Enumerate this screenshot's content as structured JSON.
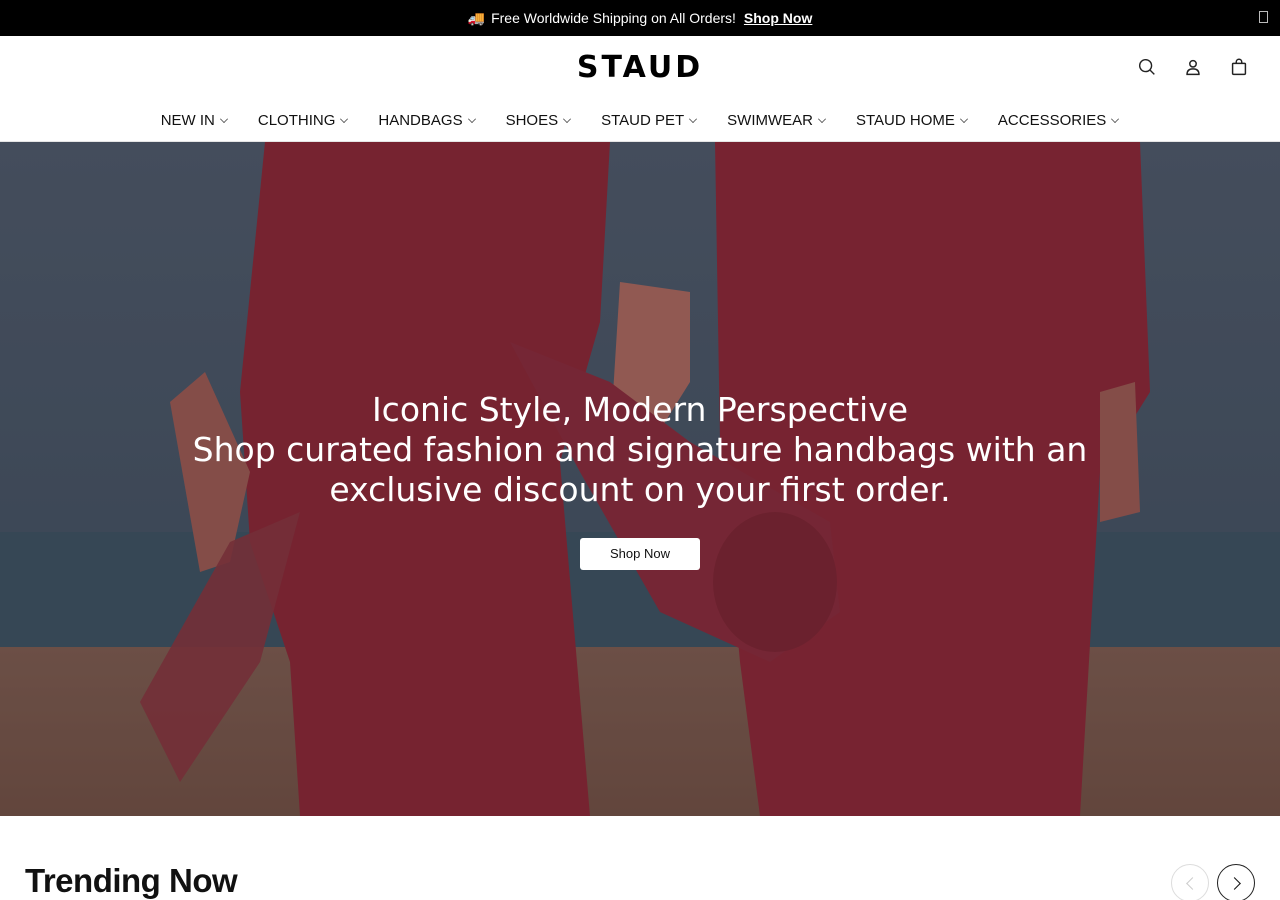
{
  "announcement": {
    "icon": "truck-icon",
    "text": "Free Worldwide Shipping on All Orders!",
    "link_label": "Shop Now"
  },
  "header": {
    "logo": "STAUD",
    "icons": [
      "search-icon",
      "account-icon",
      "bag-icon"
    ]
  },
  "nav": {
    "items": [
      {
        "label": "NEW IN"
      },
      {
        "label": "CLOTHING"
      },
      {
        "label": "HANDBAGS"
      },
      {
        "label": "SHOES"
      },
      {
        "label": "STAUD PET"
      },
      {
        "label": "SWIMWEAR"
      },
      {
        "label": "STAUD HOME"
      },
      {
        "label": "ACCESSORIES"
      }
    ]
  },
  "hero": {
    "title": "Iconic Style, Modern Perspective",
    "subtitle": "Shop curated fashion and signature handbags with an exclusive discount on your first order.",
    "button_label": "Shop Now",
    "colors": {
      "sky": "#3d6e80",
      "sea": "#2f6a7a",
      "sand": "#8a7b66",
      "garment": "#8f2f3e",
      "overlay": "#5c1a24"
    }
  },
  "trending": {
    "title": "Trending Now"
  }
}
